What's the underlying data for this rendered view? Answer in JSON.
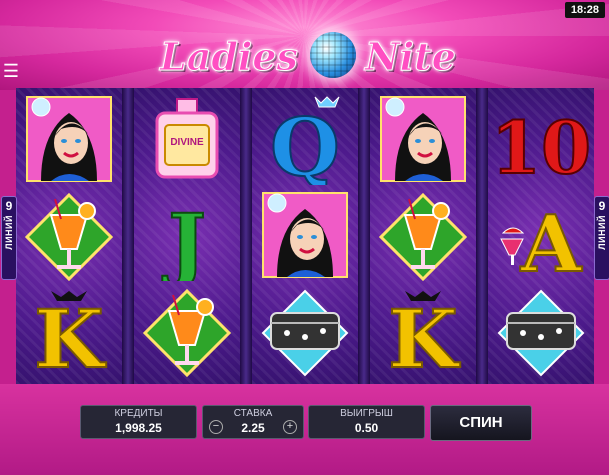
{
  "status": {
    "time": "18:28"
  },
  "logo": {
    "left_word": "Ladies",
    "right_word": "Nite"
  },
  "paylines": {
    "count": "9",
    "word": "ЛИНИЙ"
  },
  "reels": [
    [
      "lady-symbol",
      "cocktail-symbol",
      "king-symbol"
    ],
    [
      "perfume-symbol",
      "jack-symbol",
      "cocktail-symbol"
    ],
    [
      "queen-symbol",
      "lady-symbol",
      "purse-symbol"
    ],
    [
      "lady-symbol",
      "cocktail-symbol",
      "king-symbol"
    ],
    [
      "ten-symbol",
      "ace-symbol",
      "purse-symbol"
    ]
  ],
  "symbols": {
    "perfume_label": "DIVINE",
    "king": "K",
    "queen": "Q",
    "jack": "J",
    "ace": "A",
    "ten": "10"
  },
  "panel": {
    "credits_label": "КРЕДИТЫ",
    "credits_value": "1,998.25",
    "bet_label": "СТАВКА",
    "bet_value": "2.25",
    "win_label": "ВЫИГРЫШ",
    "win_value": "0.50",
    "spin_label": "СПИН",
    "minus": "−",
    "plus": "+"
  },
  "colors": {
    "background": "#c4208e",
    "reel_bg": "#4d1a8c",
    "gold": "#f2c200",
    "red": "#e01818",
    "green": "#1fa52a",
    "blue": "#1e90e6"
  }
}
